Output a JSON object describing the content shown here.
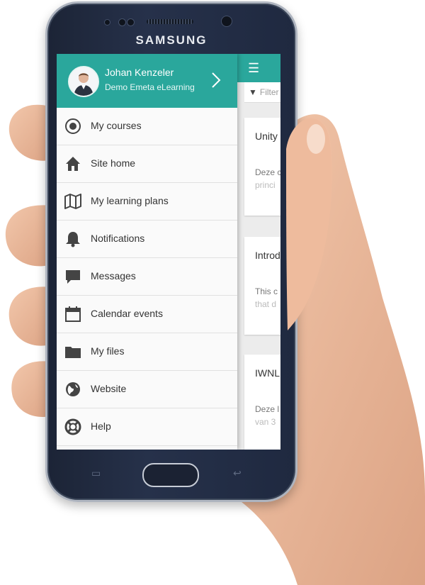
{
  "device": {
    "brand": "SAMSUNG"
  },
  "drawer": {
    "user_name": "Johan Kenzeler",
    "site_name": "Demo Emeta eLearning",
    "menu": [
      {
        "label": "My courses",
        "icon": "courses-icon"
      },
      {
        "label": "Site home",
        "icon": "home-icon"
      },
      {
        "label": "My learning plans",
        "icon": "map-icon"
      },
      {
        "label": "Notifications",
        "icon": "bell-icon"
      },
      {
        "label": "Messages",
        "icon": "chat-bubble-icon"
      },
      {
        "label": "Calendar events",
        "icon": "calendar-icon"
      },
      {
        "label": "My files",
        "icon": "folder-icon"
      },
      {
        "label": "Website",
        "icon": "globe-icon"
      },
      {
        "label": "Help",
        "icon": "lifebuoy-icon"
      }
    ]
  },
  "background_app": {
    "filter_placeholder": "Filter",
    "cards": [
      {
        "title": "Unity",
        "line1": "Deze c",
        "line2": "princi"
      },
      {
        "title": "Introd",
        "line1": "This c",
        "line2": "that d"
      },
      {
        "title": "IWNL",
        "line1": "Deze l",
        "line2": "van 3"
      }
    ]
  },
  "colors": {
    "accent": "#2aa79c",
    "phone_body": "#1f2940",
    "skin": "#e9b89a"
  }
}
